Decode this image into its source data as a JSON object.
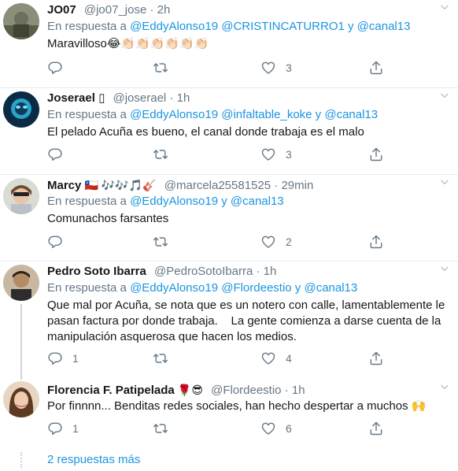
{
  "tweets": [
    {
      "name": "JO07",
      "name_suffix": "",
      "handle": "@jo07_jose",
      "time": "2h",
      "reply_prefix": "En respuesta a",
      "mentions_text": "@EddyAlonso19 @CRISTINCATURRO1 y @canal13",
      "text": "Maravilloso😂👏🏻👏🏻👏🏻👏🏻👏🏻👏🏻",
      "reply_count": "",
      "like_count": "3"
    },
    {
      "name": "Joserael",
      "name_suffix": "▯",
      "handle": "@joserael",
      "time": "1h",
      "reply_prefix": "En respuesta a",
      "mentions_text": "@EddyAlonso19 @infaltable_koke y @canal13",
      "text": "El pelado Acuña es bueno, el canal donde trabaja es el malo",
      "reply_count": "",
      "like_count": "3"
    },
    {
      "name": "Marcy",
      "name_suffix": "🇨🇱 🎶🎶🎵🎸",
      "handle": "@marcela25581525",
      "time": "29min",
      "reply_prefix": "En respuesta a",
      "mentions_text": "@EddyAlonso19 y @canal13",
      "text": "Comunachos farsantes",
      "reply_count": "",
      "like_count": "2"
    },
    {
      "name": "Pedro Soto Ibarra",
      "name_suffix": "",
      "handle": "@PedroSotoIbarra",
      "time": "1h",
      "reply_prefix": "En respuesta a",
      "mentions_text": "@EddyAlonso19 @Flordeestio y @canal13",
      "text": "Que mal por Acuña, se nota que es un notero con calle, lamentablemente le pasan factura por donde trabaja.    La gente comienza a darse cuenta de la manipulación asquerosa que hacen los medios.",
      "reply_count": "1",
      "like_count": "4"
    },
    {
      "name": "Florencia F. Patipelada",
      "name_suffix": "🌹😎",
      "handle": "@Flordeestio",
      "time": "1h",
      "reply_prefix": "",
      "mentions_text": "",
      "text": "Por finnnn... Benditas redes sociales, han hecho despertar a muchos 🙌",
      "reply_count": "1",
      "like_count": "6"
    }
  ],
  "more_replies": "2 respuestas más",
  "icons": {
    "reply": "reply-icon",
    "retweet": "retweet-icon",
    "like": "heart-icon",
    "share": "share-icon",
    "caret": "chevron-down-icon"
  },
  "colors": {
    "link": "#1b95e0",
    "muted": "#657786",
    "divider": "#e6ecf0"
  }
}
